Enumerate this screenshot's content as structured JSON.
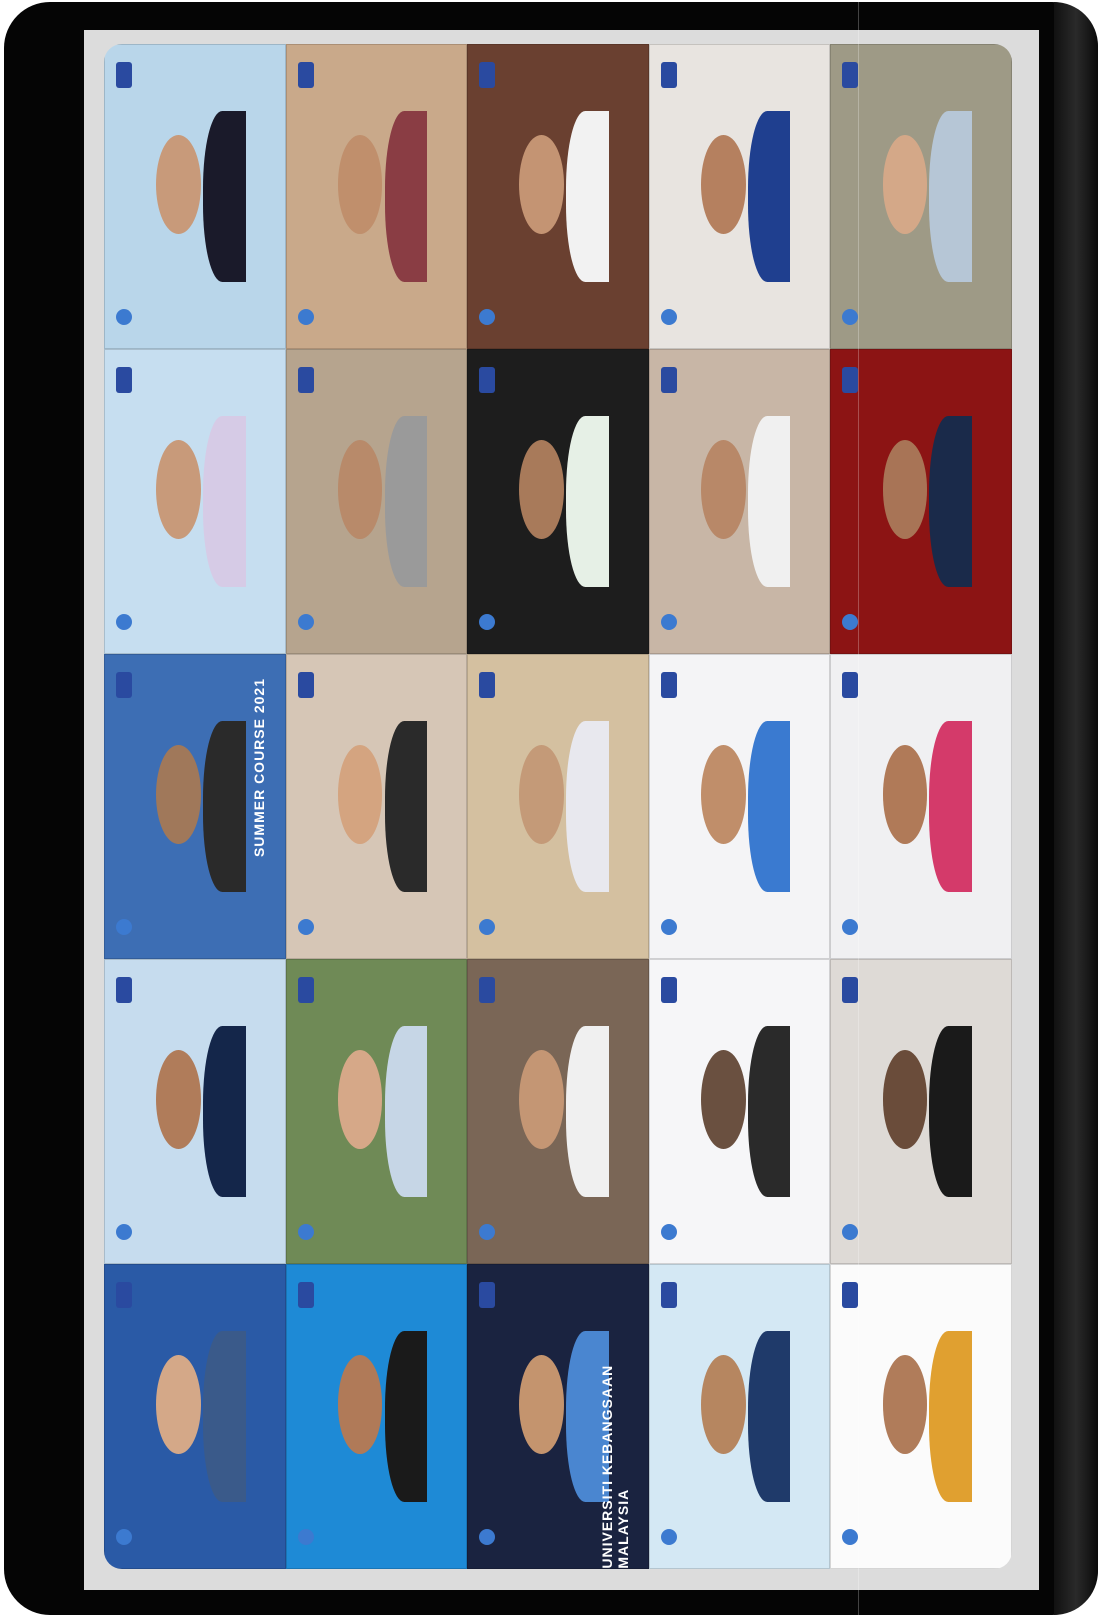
{
  "screen": {
    "tiles": [
      {
        "id": "1",
        "bg": "#b9d6ea",
        "skin": "#c89a7a",
        "cloth": "#1a1a2a",
        "caption": ""
      },
      {
        "id": "2",
        "bg": "#c9a98a",
        "skin": "#c08f6c",
        "cloth": "#8a3d44",
        "caption": ""
      },
      {
        "id": "3",
        "bg": "#6a4030",
        "skin": "#c49473",
        "cloth": "#f2f2f2",
        "caption": ""
      },
      {
        "id": "4",
        "bg": "#e8e4e0",
        "skin": "#b5805f",
        "cloth": "#1f3f8f",
        "caption": ""
      },
      {
        "id": "5",
        "bg": "#9e9a86",
        "skin": "#d4a888",
        "cloth": "#b6c6d6",
        "caption": ""
      },
      {
        "id": "6",
        "bg": "#c6def0",
        "skin": "#c89a7a",
        "cloth": "#d6cbe6",
        "caption": ""
      },
      {
        "id": "7",
        "bg": "#b6a48e",
        "skin": "#b88a6a",
        "cloth": "#9a9a9a",
        "caption": ""
      },
      {
        "id": "8",
        "bg": "#1d1d1d",
        "skin": "#a87a5a",
        "cloth": "#e6f0e6",
        "caption": ""
      },
      {
        "id": "9",
        "bg": "#c8b6a6",
        "skin": "#b88868",
        "cloth": "#f0f0f0",
        "caption": ""
      },
      {
        "id": "10",
        "bg": "#8c1414",
        "skin": "#a87456",
        "cloth": "#1a2a4a",
        "caption": ""
      },
      {
        "id": "11",
        "bg": "#3d6eb4",
        "skin": "#a0785a",
        "cloth": "#2a2a2a",
        "caption": "SUMMER COURSE 2021"
      },
      {
        "id": "12",
        "bg": "#d6c6b6",
        "skin": "#d4a480",
        "cloth": "#2a2a2a",
        "caption": ""
      },
      {
        "id": "13",
        "bg": "#d4c0a0",
        "skin": "#c49a78",
        "cloth": "#e8e8ee",
        "caption": ""
      },
      {
        "id": "14",
        "bg": "#f4f4f6",
        "skin": "#c08e6a",
        "cloth": "#3a7ad0",
        "caption": ""
      },
      {
        "id": "15",
        "bg": "#f0f0f2",
        "skin": "#b07a58",
        "cloth": "#d43a6a",
        "caption": ""
      },
      {
        "id": "16",
        "bg": "#c6dcee",
        "skin": "#b07c5a",
        "cloth": "#14264a",
        "caption": ""
      },
      {
        "id": "17",
        "bg": "#6f8a56",
        "skin": "#d6a888",
        "cloth": "#c6d6e6",
        "caption": ""
      },
      {
        "id": "18",
        "bg": "#7a6656",
        "skin": "#c49674",
        "cloth": "#f0f0f0",
        "caption": ""
      },
      {
        "id": "19",
        "bg": "#f6f6f8",
        "skin": "#6a5040",
        "cloth": "#2a2a2a",
        "caption": ""
      },
      {
        "id": "20",
        "bg": "#dedad6",
        "skin": "#6a4c3a",
        "cloth": "#1a1a1a",
        "caption": ""
      },
      {
        "id": "21",
        "bg": "#2a5aa6",
        "skin": "#d4a888",
        "cloth": "#3a5a8a",
        "caption": ""
      },
      {
        "id": "22",
        "bg": "#1e8ad6",
        "skin": "#b07a58",
        "cloth": "#1a1a1a",
        "caption": ""
      },
      {
        "id": "23",
        "bg": "#1a2340",
        "skin": "#c4946e",
        "cloth": "#4a86d0",
        "caption": "UNIVERSITI KEBANGSAAN MALAYSIA"
      },
      {
        "id": "24",
        "bg": "#d4e8f4",
        "skin": "#b68660",
        "cloth": "#1f3a6a",
        "caption": ""
      },
      {
        "id": "25",
        "bg": "#fbfbfb",
        "skin": "#b07c5a",
        "cloth": "#e0a030",
        "caption": ""
      }
    ]
  }
}
